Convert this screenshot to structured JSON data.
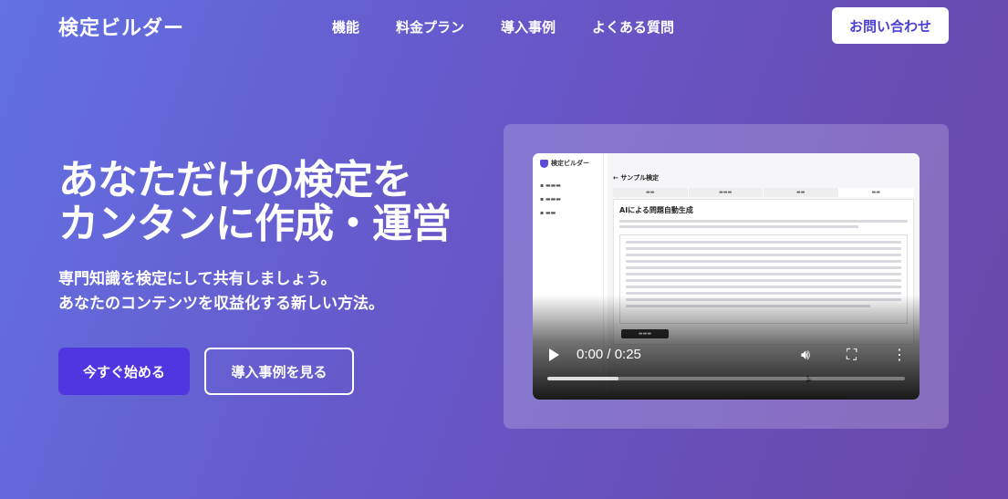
{
  "header": {
    "logo": "検定ビルダー",
    "nav": [
      "機能",
      "料金プラン",
      "導入事例",
      "よくある質問"
    ],
    "contact_label": "お問い合わせ"
  },
  "hero": {
    "title_line1": "あなただけの検定を",
    "title_line2": "カンタンに作成・運営",
    "subtitle_line1": "専門知識を検定にして共有しましょう。",
    "subtitle_line2": "あなたのコンテンツを収益化する新しい方法。",
    "primary_cta": "今すぐ始める",
    "secondary_cta": "導入事例を見る"
  },
  "video": {
    "time": "0:00 / 0:25",
    "progress_fraction": 0.2,
    "app_logo": "検定ビルダー",
    "app_page_title": "サンプル検定",
    "app_panel_title": "AIによる問題自動生成",
    "icons": [
      "play-icon",
      "volume-icon",
      "fullscreen-icon",
      "more-vertical-icon"
    ]
  },
  "colors": {
    "accent": "#4f36e0",
    "contact_text": "#4a3fd1"
  }
}
